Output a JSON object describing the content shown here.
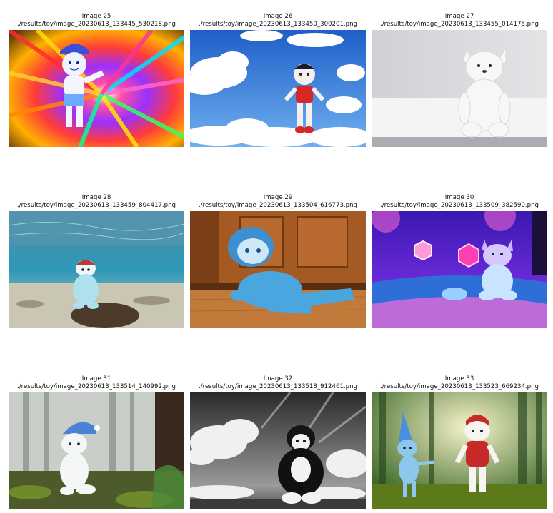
{
  "images": [
    {
      "title": "Image 25",
      "path": "./results/toy/image_20230613_133445_530218.png",
      "scene": "rainbow-burst"
    },
    {
      "title": "Image 26",
      "path": "./results/toy/image_20230613_133450_300201.png",
      "scene": "sky-clouds"
    },
    {
      "title": "Image 27",
      "path": "./results/toy/image_20230613_133455_014175.png",
      "scene": "white-studio"
    },
    {
      "title": "Image 28",
      "path": "./results/toy/image_20230613_133459_804417.png",
      "scene": "underwater"
    },
    {
      "title": "Image 29",
      "path": "./results/toy/image_20230613_133504_616773.png",
      "scene": "wooden-room"
    },
    {
      "title": "Image 30",
      "path": "./results/toy/image_20230613_133509_382590.png",
      "scene": "neon-room"
    },
    {
      "title": "Image 31",
      "path": "./results/toy/image_20230613_133514_140992.png",
      "scene": "forest"
    },
    {
      "title": "Image 32",
      "path": "./results/toy/image_20230613_133518_912461.png",
      "scene": "monochrome-clouds"
    },
    {
      "title": "Image 33",
      "path": "./results/toy/image_20230613_133523_669234.png",
      "scene": "forest-two-toys"
    }
  ]
}
